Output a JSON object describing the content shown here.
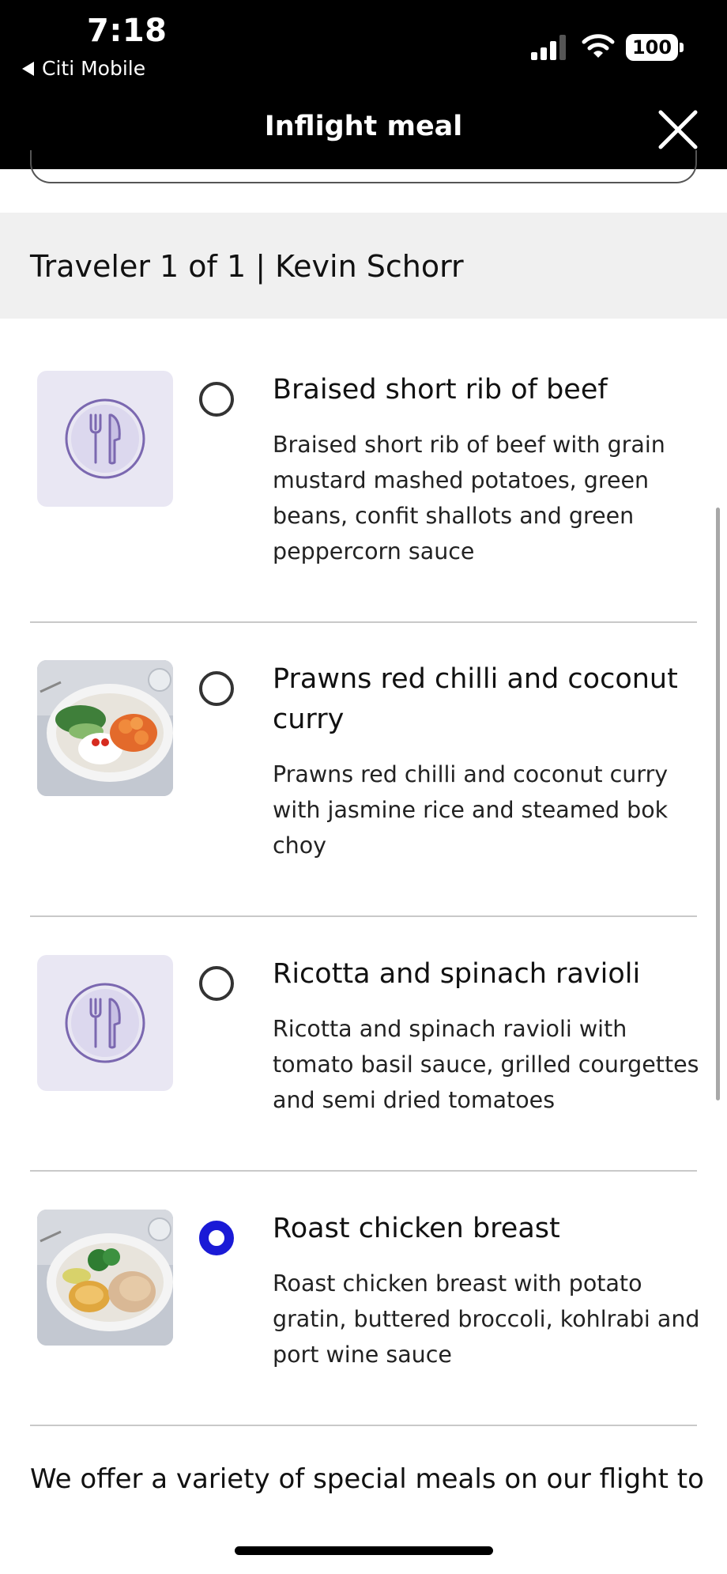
{
  "status_bar": {
    "time": "7:18",
    "back_app": "Citi Mobile",
    "battery": "100"
  },
  "header": {
    "title": "Inflight meal",
    "close_icon": "close-icon"
  },
  "traveler": {
    "label": "Traveler 1 of 1 | Kevin Schorr"
  },
  "meals": [
    {
      "title": "Braised short rib of beef",
      "description": "Braised short rib of beef with grain mustard mashed potatoes, green beans, confit shallots and green peppercorn sauce",
      "image": "cutlery-placeholder-icon",
      "selected": false
    },
    {
      "title": "Prawns red chilli and coconut curry",
      "description": "Prawns red chilli and coconut curry with jasmine rice and steamed bok choy",
      "image": "prawn-curry-photo",
      "selected": false
    },
    {
      "title": "Ricotta and spinach ravioli",
      "description": "Ricotta and spinach ravioli with tomato basil sauce, grilled courgettes and semi dried tomatoes",
      "image": "cutlery-placeholder-icon",
      "selected": false
    },
    {
      "title": "Roast chicken breast",
      "description": "Roast chicken breast with potato gratin, buttered broccoli, kohlrabi and port wine sauce",
      "image": "roast-chicken-photo",
      "selected": true
    }
  ],
  "footer": {
    "text": "We offer a variety of special meals on our flight to"
  },
  "colors": {
    "header_bg": "#000000",
    "selected_radio": "#1a1ad6",
    "band_bg": "#f0f0f0",
    "placeholder_bg": "#e9e7f3",
    "placeholder_icon": "#7b68b0"
  }
}
